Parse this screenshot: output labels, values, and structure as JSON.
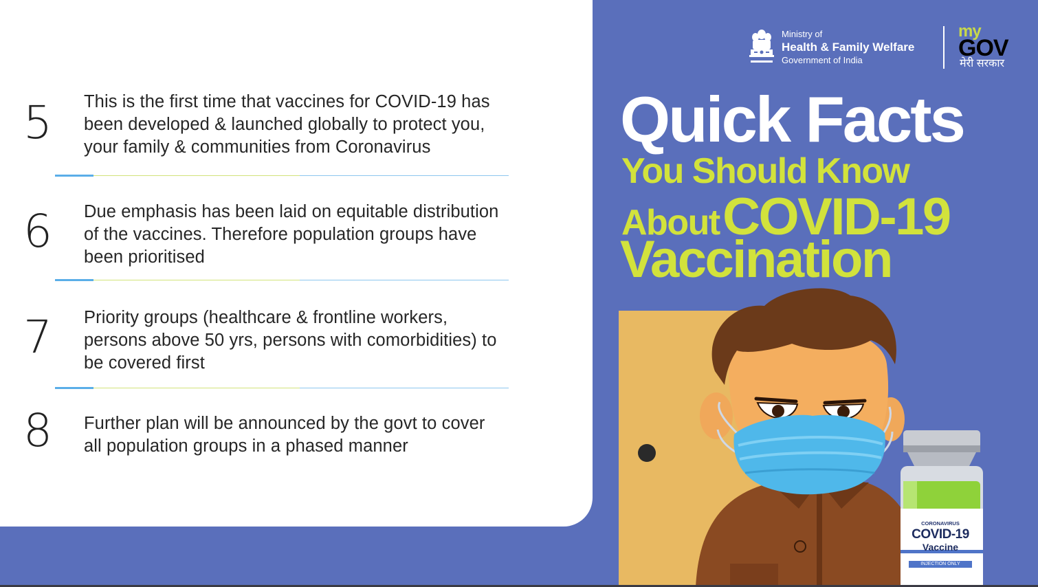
{
  "facts": [
    {
      "number": "5",
      "text": "This is the first time that vaccines for COVID-19 has\nbeen developed & launched globally to protect you,\nyour family & communities from Coronavirus"
    },
    {
      "number": "6",
      "text": "Due emphasis has been laid on equitable distribution\nof the vaccines. Therefore population groups have\nbeen prioritised"
    },
    {
      "number": "7",
      "text": "Priority groups (healthcare & frontline workers,\npersons above 50 yrs, persons with comorbidities) to\nbe covered first"
    },
    {
      "number": "8",
      "text": "Further plan will be announced by the govt to cover\nall population groups in a phased manner"
    }
  ],
  "header": {
    "ministry_line1": "Ministry of",
    "ministry_line2": "Health & Family Welfare",
    "ministry_line3": "Government of India",
    "mygov_top": "my",
    "mygov_gov": "GOV",
    "mygov_subtitle": "मेरी सरकार"
  },
  "heading": {
    "line1": "Quick Facts",
    "line2": "You Should Know",
    "line3a": "About",
    "line3b": "COVID-19",
    "line4": "Vaccination"
  },
  "vial": {
    "small": "CORONAVIRUS",
    "name": "COVID-19",
    "type": "Vaccine",
    "note": "INJECTION ONLY"
  },
  "colors": {
    "background": "#5a6fbb",
    "card": "#ffffff",
    "accent_yellow": "#d2e23c",
    "divider_blue": "#5aaee8"
  }
}
